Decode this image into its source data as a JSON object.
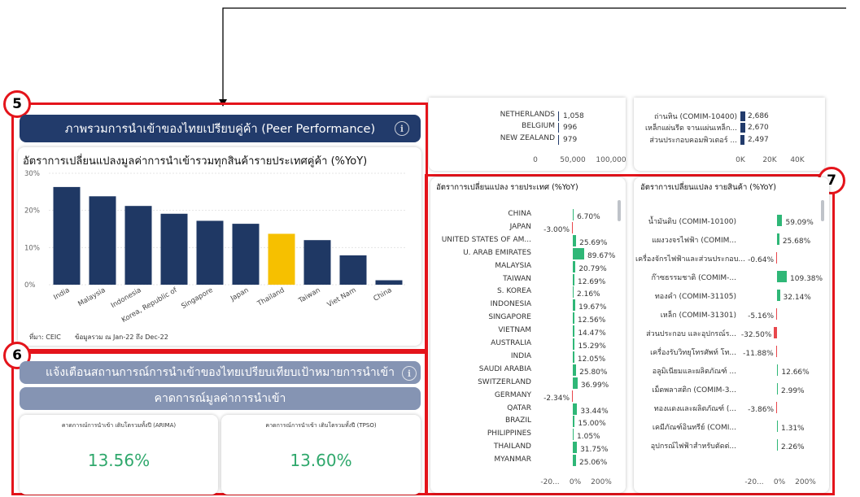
{
  "annotations": {
    "c5": "5",
    "c6": "6",
    "c7": "7"
  },
  "top_partial": {
    "countries": [
      {
        "label": "NETHERLANDS",
        "value": "1,058"
      },
      {
        "label": "BELGIUM",
        "value": "996"
      },
      {
        "label": "NEW ZEALAND",
        "value": "979"
      }
    ],
    "countries_axis": [
      "0",
      "50,000",
      "100,000"
    ],
    "products": [
      {
        "label": "ถ่านหิน (COMIM-10400)",
        "value": "2,686"
      },
      {
        "label": "เหล็กแผ่นรีด จานแผ่นเหล็ก...",
        "value": "2,670"
      },
      {
        "label": "ส่วนประกอบคอมพิวเตอร์ ...",
        "value": "2,497"
      }
    ],
    "products_axis": [
      "0K",
      "20K",
      "40K"
    ],
    "bar_color": "#223b6b"
  },
  "peer": {
    "header": "ภาพรวมการนำเข้าของไทยเปรียบคู่ค้า (Peer Performance)",
    "info_icon": "info-icon",
    "chart_title": "อัตราการเปลี่ยนแปลงมูลค่าการนำเข้ารวมทุกสินค้ารายประเทศคู่ค้า (%YoY)",
    "source": "ที่มา: CEIC",
    "data_as_of": "ข้อมูลรวม ณ  Jan-22 ถึง Dec-22"
  },
  "chart_data": {
    "type": "bar",
    "categories": [
      "India",
      "Malaysia",
      "Indonesia",
      "Korea, Republic of",
      "Singapore",
      "Japan",
      "Thailand",
      "Taiwan",
      "Viet Nam",
      "China"
    ],
    "values": [
      26.3,
      23.8,
      21.2,
      19.1,
      17.2,
      16.4,
      13.7,
      12.0,
      7.9,
      1.2
    ],
    "highlight": "Thailand",
    "colors": {
      "default": "#1f3864",
      "highlight": "#f6c000"
    },
    "yticks": [
      "0%",
      "10%",
      "20%",
      "30%"
    ],
    "ylim": [
      0,
      30
    ]
  },
  "alert": {
    "header": "แจ้งเตือนสถานการณ์การนำเข้าของไทยเปรียบเทียบเป้าหมายการนำเข้า",
    "subheader": "คาดการณ์มูลค่าการนำเข้า",
    "arima_label": "คาดการณ์การนำเข้า เติบโตรวมทั้งปี (ARIMA)",
    "arima_value": "13.56%",
    "tpso_label": "คาดการณ์การนำเข้า เติบโตรวมทั้งปี (TPSO)",
    "tpso_value": "13.60%",
    "value_color": "#2fa86c"
  },
  "country_yoy": {
    "title": "อัตราการเปลี่ยนแปลง รายประเทศ (%YoY)",
    "rows": [
      {
        "label": "CHINA",
        "text": "6.70%",
        "v": 6.7
      },
      {
        "label": "JAPAN",
        "text": "-3.00%",
        "v": -3.0
      },
      {
        "label": "UNITED STATES OF AM...",
        "text": "25.69%",
        "v": 25.69
      },
      {
        "label": "U. ARAB EMIRATES",
        "text": "89.67%",
        "v": 89.67
      },
      {
        "label": "MALAYSIA",
        "text": "20.79%",
        "v": 20.79
      },
      {
        "label": "TAIWAN",
        "text": "12.69%",
        "v": 12.69
      },
      {
        "label": "S. KOREA",
        "text": "2.16%",
        "v": 2.16
      },
      {
        "label": "INDONESIA",
        "text": "19.67%",
        "v": 19.67
      },
      {
        "label": "SINGAPORE",
        "text": "12.56%",
        "v": 12.56
      },
      {
        "label": "VIETNAM",
        "text": "14.47%",
        "v": 14.47
      },
      {
        "label": "AUSTRALIA",
        "text": "15.29%",
        "v": 15.29
      },
      {
        "label": "INDIA",
        "text": "12.05%",
        "v": 12.05
      },
      {
        "label": "SAUDI ARABIA",
        "text": "25.80%",
        "v": 25.8
      },
      {
        "label": "SWITZERLAND",
        "text": "36.99%",
        "v": 36.99
      },
      {
        "label": "GERMANY",
        "text": "-2.34%",
        "v": -2.34
      },
      {
        "label": "QATAR",
        "text": "33.44%",
        "v": 33.44
      },
      {
        "label": "BRAZIL",
        "text": "15.00%",
        "v": 15.0
      },
      {
        "label": "PHILIPPINES",
        "text": "1.05%",
        "v": 1.05
      },
      {
        "label": "THAILAND",
        "text": "31.75%",
        "v": 31.75
      },
      {
        "label": "MYANMAR",
        "text": "25.06%",
        "v": 25.06
      }
    ],
    "axis": [
      "-20...",
      "0%",
      "200%"
    ]
  },
  "product_yoy": {
    "title": "อัตราการเปลี่ยนแปลง รายสินค้า (%YoY)",
    "rows": [
      {
        "label": "น้ำมันดิบ (COMIM-10100)",
        "text": "59.09%",
        "v": 59.09
      },
      {
        "label": "แผงวงจรไฟฟ้า (COMIM...",
        "text": "25.68%",
        "v": 25.68
      },
      {
        "label": "เครื่องจักรไฟฟ้าและส่วนประกอบ...",
        "text": "-0.64%",
        "v": -0.64
      },
      {
        "label": "ก๊าซธรรมชาติ (COMIM-...",
        "text": "109.38%",
        "v": 109.38
      },
      {
        "label": "ทองคำ (COMIM-31105)",
        "text": "32.14%",
        "v": 32.14
      },
      {
        "label": "เหล็ก (COMIM-31301)",
        "text": "-5.16%",
        "v": -5.16
      },
      {
        "label": "ส่วนประกอบ และอุปกรณ์ร...",
        "text": "-32.50%",
        "v": -32.5
      },
      {
        "label": "เครื่องรับวิทยุโทรศัพท์ โท...",
        "text": "-11.88%",
        "v": -11.88
      },
      {
        "label": "อลูมิเนียมและผลิตภัณฑ์ ...",
        "text": "12.66%",
        "v": 12.66
      },
      {
        "label": "เม็ดพลาสติก (COMIM-3...",
        "text": "2.99%",
        "v": 2.99
      },
      {
        "label": "ทองแดงและผลิตภัณฑ์ (...",
        "text": "-3.86%",
        "v": -3.86
      },
      {
        "label": "เคมีภัณฑ์อินทรีย์ (COMI...",
        "text": "1.31%",
        "v": 1.31
      },
      {
        "label": "อุปกรณ์ไฟฟ้าสำหรับตัดต่...",
        "text": "2.26%",
        "v": 2.26
      }
    ],
    "axis": [
      "-20...",
      "0%",
      "200%"
    ]
  },
  "colors": {
    "positive": "#2fb777",
    "negative": "#e8474c",
    "annotation": "#e4141b"
  }
}
